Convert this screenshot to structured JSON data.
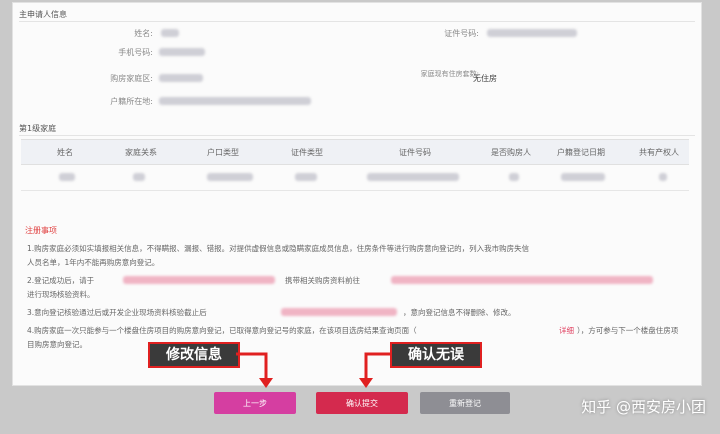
{
  "section_applicant": {
    "title": "主申请人信息",
    "labels": {
      "name": "姓名:",
      "phone": "手机号码:",
      "household_area": "购房家庭区:",
      "hukou_location": "户籍所在地:",
      "id_number": "证件号码:",
      "housing_status": "家庭现有住房套数:"
    },
    "housing_status_value": "无住房"
  },
  "section_family": {
    "title": "第1级家庭",
    "columns": [
      "姓名",
      "家庭关系",
      "户口类型",
      "证件类型",
      "证件号码",
      "是否购房人",
      "户籍登记日期",
      "共有产权人"
    ]
  },
  "notes": {
    "title": "注册事项",
    "lines": [
      "1.购房家庭必须如实填报相关信息，不得瞒报、漏报、错报。对提供虚假信息或隐瞒家庭成员信息，住房条件等进行购房意向登记的，列入我市购房失信",
      "人员名单，1年内不能再购房意向登记。",
      "2.登记成功后，请于",
      "携带相关购房资料前往",
      "进行现场核验资料。",
      "3.意向登记核验通过后或开发企业现场资料核验截止后",
      "，意向登记信息不得删除、修改。",
      "4.购房家庭一次只能参与一个楼盘住房项目的购房意向登记，已取得意向登记号的家庭，在该项目选房结果查询页面（",
      "），方可参与下一个楼盘住房项",
      "目购房意向登记。"
    ],
    "inline_red": "详细"
  },
  "buttons": {
    "prev": "上一步",
    "confirm": "确认提交",
    "reset": "重新登记"
  },
  "callouts": {
    "modify": "修改信息",
    "confirm": "确认无误"
  },
  "watermark": "知乎 @西安房小团",
  "colors": {
    "prev_button": "#d53ea1",
    "confirm_button": "#d42a4e",
    "reset_button": "#8e8e94",
    "callout_border": "#e02020"
  }
}
